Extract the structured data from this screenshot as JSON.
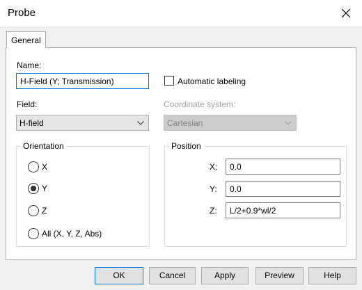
{
  "window": {
    "title": "Probe"
  },
  "tabs": [
    {
      "label": "General"
    }
  ],
  "name_field": {
    "label": "Name:",
    "value": "H-Field (Y; Transmission)"
  },
  "auto_labeling": {
    "label": "Automatic labeling",
    "checked": false
  },
  "field": {
    "label": "Field:",
    "selected": "H-field"
  },
  "coordinate_system": {
    "label": "Coordinate system:",
    "selected": "Cartesian",
    "enabled": false
  },
  "orientation": {
    "title": "Orientation",
    "options": [
      {
        "label": "X",
        "checked": false
      },
      {
        "label": "Y",
        "checked": true
      },
      {
        "label": "Z",
        "checked": false
      },
      {
        "label": "All (X, Y, Z, Abs)",
        "checked": false
      }
    ]
  },
  "position": {
    "title": "Position",
    "fields": [
      {
        "label": "X:",
        "value": "0.0"
      },
      {
        "label": "Y:",
        "value": "0.0"
      },
      {
        "label": "Z:",
        "value": "L/2+0.9*wl/2"
      }
    ]
  },
  "buttons": {
    "ok": "OK",
    "cancel": "Cancel",
    "apply": "Apply",
    "preview": "Preview",
    "help": "Help"
  }
}
